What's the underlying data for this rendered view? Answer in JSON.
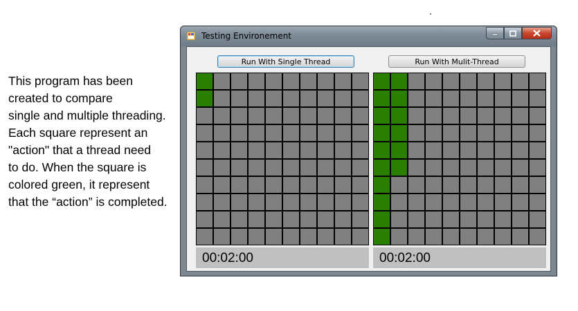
{
  "description": [
    "This program has been",
    "created to compare",
    "single and multiple threading.",
    " Each square represent an",
    "\"action\" that a thread need",
    "to do. When the square is",
    "colored green, it represent",
    "that the “action” is completed."
  ],
  "window": {
    "title": "Testing Environement",
    "caption_buttons": [
      "minimize-icon",
      "maximize-icon",
      "close-icon"
    ]
  },
  "single": {
    "button_label": "Run With Single Thread",
    "timer": "00:02:00",
    "rows": 10,
    "cols": 10,
    "completed_cells": [
      [
        0,
        0
      ],
      [
        1,
        0
      ]
    ]
  },
  "multi": {
    "button_label": "Run With Mulit-Thread",
    "timer": "00:02:00",
    "rows": 10,
    "cols": 10,
    "completed_cells": [
      [
        0,
        0
      ],
      [
        0,
        1
      ],
      [
        1,
        0
      ],
      [
        1,
        1
      ],
      [
        2,
        0
      ],
      [
        2,
        1
      ],
      [
        3,
        0
      ],
      [
        3,
        1
      ],
      [
        4,
        0
      ],
      [
        4,
        1
      ],
      [
        5,
        0
      ],
      [
        5,
        1
      ],
      [
        6,
        0
      ],
      [
        7,
        0
      ],
      [
        8,
        0
      ],
      [
        9,
        0
      ]
    ]
  },
  "colors": {
    "completed": "#2a7f00",
    "pending": "#808080"
  }
}
